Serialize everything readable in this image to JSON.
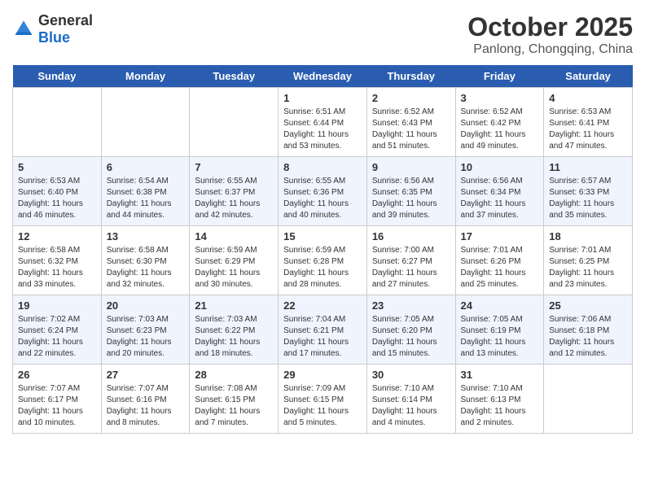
{
  "header": {
    "logo_general": "General",
    "logo_blue": "Blue",
    "month": "October 2025",
    "location": "Panlong, Chongqing, China"
  },
  "days_of_week": [
    "Sunday",
    "Monday",
    "Tuesday",
    "Wednesday",
    "Thursday",
    "Friday",
    "Saturday"
  ],
  "weeks": [
    {
      "cells": [
        {
          "day": "",
          "info": ""
        },
        {
          "day": "",
          "info": ""
        },
        {
          "day": "",
          "info": ""
        },
        {
          "day": "1",
          "info": "Sunrise: 6:51 AM\nSunset: 6:44 PM\nDaylight: 11 hours\nand 53 minutes."
        },
        {
          "day": "2",
          "info": "Sunrise: 6:52 AM\nSunset: 6:43 PM\nDaylight: 11 hours\nand 51 minutes."
        },
        {
          "day": "3",
          "info": "Sunrise: 6:52 AM\nSunset: 6:42 PM\nDaylight: 11 hours\nand 49 minutes."
        },
        {
          "day": "4",
          "info": "Sunrise: 6:53 AM\nSunset: 6:41 PM\nDaylight: 11 hours\nand 47 minutes."
        }
      ]
    },
    {
      "cells": [
        {
          "day": "5",
          "info": "Sunrise: 6:53 AM\nSunset: 6:40 PM\nDaylight: 11 hours\nand 46 minutes."
        },
        {
          "day": "6",
          "info": "Sunrise: 6:54 AM\nSunset: 6:38 PM\nDaylight: 11 hours\nand 44 minutes."
        },
        {
          "day": "7",
          "info": "Sunrise: 6:55 AM\nSunset: 6:37 PM\nDaylight: 11 hours\nand 42 minutes."
        },
        {
          "day": "8",
          "info": "Sunrise: 6:55 AM\nSunset: 6:36 PM\nDaylight: 11 hours\nand 40 minutes."
        },
        {
          "day": "9",
          "info": "Sunrise: 6:56 AM\nSunset: 6:35 PM\nDaylight: 11 hours\nand 39 minutes."
        },
        {
          "day": "10",
          "info": "Sunrise: 6:56 AM\nSunset: 6:34 PM\nDaylight: 11 hours\nand 37 minutes."
        },
        {
          "day": "11",
          "info": "Sunrise: 6:57 AM\nSunset: 6:33 PM\nDaylight: 11 hours\nand 35 minutes."
        }
      ]
    },
    {
      "cells": [
        {
          "day": "12",
          "info": "Sunrise: 6:58 AM\nSunset: 6:32 PM\nDaylight: 11 hours\nand 33 minutes."
        },
        {
          "day": "13",
          "info": "Sunrise: 6:58 AM\nSunset: 6:30 PM\nDaylight: 11 hours\nand 32 minutes."
        },
        {
          "day": "14",
          "info": "Sunrise: 6:59 AM\nSunset: 6:29 PM\nDaylight: 11 hours\nand 30 minutes."
        },
        {
          "day": "15",
          "info": "Sunrise: 6:59 AM\nSunset: 6:28 PM\nDaylight: 11 hours\nand 28 minutes."
        },
        {
          "day": "16",
          "info": "Sunrise: 7:00 AM\nSunset: 6:27 PM\nDaylight: 11 hours\nand 27 minutes."
        },
        {
          "day": "17",
          "info": "Sunrise: 7:01 AM\nSunset: 6:26 PM\nDaylight: 11 hours\nand 25 minutes."
        },
        {
          "day": "18",
          "info": "Sunrise: 7:01 AM\nSunset: 6:25 PM\nDaylight: 11 hours\nand 23 minutes."
        }
      ]
    },
    {
      "cells": [
        {
          "day": "19",
          "info": "Sunrise: 7:02 AM\nSunset: 6:24 PM\nDaylight: 11 hours\nand 22 minutes."
        },
        {
          "day": "20",
          "info": "Sunrise: 7:03 AM\nSunset: 6:23 PM\nDaylight: 11 hours\nand 20 minutes."
        },
        {
          "day": "21",
          "info": "Sunrise: 7:03 AM\nSunset: 6:22 PM\nDaylight: 11 hours\nand 18 minutes."
        },
        {
          "day": "22",
          "info": "Sunrise: 7:04 AM\nSunset: 6:21 PM\nDaylight: 11 hours\nand 17 minutes."
        },
        {
          "day": "23",
          "info": "Sunrise: 7:05 AM\nSunset: 6:20 PM\nDaylight: 11 hours\nand 15 minutes."
        },
        {
          "day": "24",
          "info": "Sunrise: 7:05 AM\nSunset: 6:19 PM\nDaylight: 11 hours\nand 13 minutes."
        },
        {
          "day": "25",
          "info": "Sunrise: 7:06 AM\nSunset: 6:18 PM\nDaylight: 11 hours\nand 12 minutes."
        }
      ]
    },
    {
      "cells": [
        {
          "day": "26",
          "info": "Sunrise: 7:07 AM\nSunset: 6:17 PM\nDaylight: 11 hours\nand 10 minutes."
        },
        {
          "day": "27",
          "info": "Sunrise: 7:07 AM\nSunset: 6:16 PM\nDaylight: 11 hours\nand 8 minutes."
        },
        {
          "day": "28",
          "info": "Sunrise: 7:08 AM\nSunset: 6:15 PM\nDaylight: 11 hours\nand 7 minutes."
        },
        {
          "day": "29",
          "info": "Sunrise: 7:09 AM\nSunset: 6:15 PM\nDaylight: 11 hours\nand 5 minutes."
        },
        {
          "day": "30",
          "info": "Sunrise: 7:10 AM\nSunset: 6:14 PM\nDaylight: 11 hours\nand 4 minutes."
        },
        {
          "day": "31",
          "info": "Sunrise: 7:10 AM\nSunset: 6:13 PM\nDaylight: 11 hours\nand 2 minutes."
        },
        {
          "day": "",
          "info": ""
        }
      ]
    }
  ]
}
